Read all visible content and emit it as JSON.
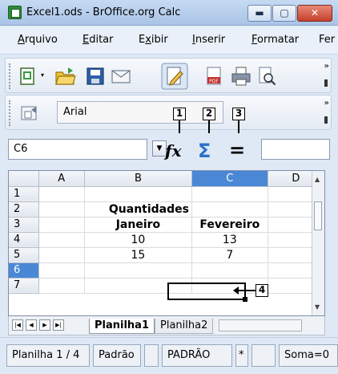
{
  "window": {
    "title": "Excel1.ods - BrOffice.org Calc",
    "min_glyph": "▬",
    "max_glyph": "▢",
    "close_glyph": "✕"
  },
  "menu": {
    "items": [
      {
        "label": "Arquivo",
        "accel": "A",
        "rest": "rquivo"
      },
      {
        "label": "Editar",
        "accel": "E",
        "rest": "ditar"
      },
      {
        "label": "Exibir",
        "accel": "x",
        "pre": "E",
        "rest": "ibir"
      },
      {
        "label": "Inserir",
        "accel": "I",
        "rest": "nserir"
      },
      {
        "label": "Formatar",
        "accel": "F",
        "rest": "ormatar"
      },
      {
        "label": "Fer",
        "accel": "",
        "rest": "Fer"
      }
    ]
  },
  "toolbar2": {
    "font_name": "Arial"
  },
  "formula_bar": {
    "cell_reference": "C6",
    "function_wizard": "fx",
    "sum": "Σ",
    "equals": "="
  },
  "callouts": [
    "1",
    "2",
    "3",
    "4"
  ],
  "spreadsheet": {
    "columns": [
      "A",
      "B",
      "C",
      "D"
    ],
    "active_column": "C",
    "active_row": "6",
    "rows": [
      {
        "n": "1",
        "cells": [
          "",
          "",
          "",
          ""
        ]
      },
      {
        "n": "2",
        "cells": [
          "",
          "Quantidades",
          "",
          ""
        ]
      },
      {
        "n": "3",
        "cells": [
          "",
          "Janeiro",
          "Fevereiro",
          ""
        ]
      },
      {
        "n": "4",
        "cells": [
          "",
          "10",
          "13",
          ""
        ]
      },
      {
        "n": "5",
        "cells": [
          "",
          "15",
          "7",
          ""
        ]
      },
      {
        "n": "6",
        "cells": [
          "",
          "",
          "",
          ""
        ]
      },
      {
        "n": "7",
        "cells": [
          "",
          "",
          "",
          ""
        ]
      }
    ]
  },
  "sheet_tabs": {
    "tabs": [
      "Planilha1",
      "Planilha2"
    ],
    "active": "Planilha1"
  },
  "status_bar": {
    "sheet_position": "Planilha 1 / 4",
    "page_style": "Padrão",
    "mode": "PADRÃO",
    "modified": "*",
    "sum": "Soma=0"
  },
  "colors": {
    "accent_header": "#4a88d6",
    "close_button": "#c4402b",
    "sigma": "#2a72c7"
  }
}
